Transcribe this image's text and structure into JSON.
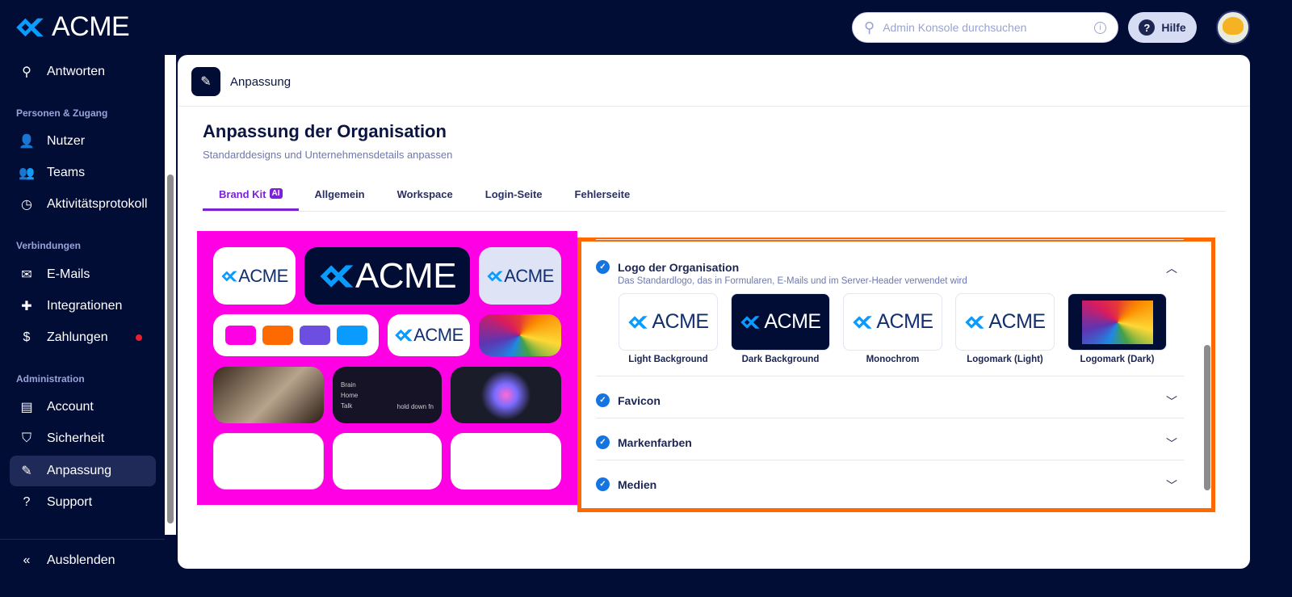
{
  "brand": {
    "name": "ACME"
  },
  "search": {
    "placeholder": "Admin Konsole durchsuchen"
  },
  "help": {
    "label": "Hilfe"
  },
  "sidebar": {
    "search_item": "Antworten",
    "sections": [
      {
        "title": "Personen & Zugang",
        "items": [
          "Nutzer",
          "Teams",
          "Aktivitätsprotokoll"
        ]
      },
      {
        "title": "Verbindungen",
        "items": [
          "E-Mails",
          "Integrationen",
          "Zahlungen"
        ]
      },
      {
        "title": "Administration",
        "items": [
          "Account",
          "Sicherheit",
          "Anpassung",
          "Support"
        ]
      }
    ],
    "active": "Anpassung",
    "collapse": "Ausblenden"
  },
  "breadcrumb": "Anpassung",
  "page": {
    "title": "Anpassung der Organisation",
    "subtitle": "Standarddesigns und Unternehmensdetails anpassen"
  },
  "tabs": [
    {
      "label": "Brand Kit",
      "badge": "AI",
      "active": true
    },
    {
      "label": "Allgemein"
    },
    {
      "label": "Workspace"
    },
    {
      "label": "Login-Seite"
    },
    {
      "label": "Fehlerseite"
    }
  ],
  "preview": {
    "swatches": [
      "#ff00e5",
      "#ff6a00",
      "#6c4ee0",
      "#0a9bff"
    ],
    "brain_label": "Brain",
    "home_label": "Home",
    "talk_label": "Talk",
    "hold_label": "hold down fn"
  },
  "accordion": [
    {
      "title": "Logo der Organisation",
      "description": "Das Standardlogo, das in Formularen, E-Mails und im Server-Header verwendet wird",
      "expanded": true,
      "variants": [
        "Light Background",
        "Dark Background",
        "Monochrom",
        "Logomark (Light)",
        "Logomark (Dark)"
      ]
    },
    {
      "title": "Favicon"
    },
    {
      "title": "Markenfarben"
    },
    {
      "title": "Medien"
    }
  ],
  "colors": {
    "sidebar": "#020d36",
    "accent": "#7b22d6",
    "highlight": "#ff6a00",
    "brand_blue": "#0a9bff"
  }
}
